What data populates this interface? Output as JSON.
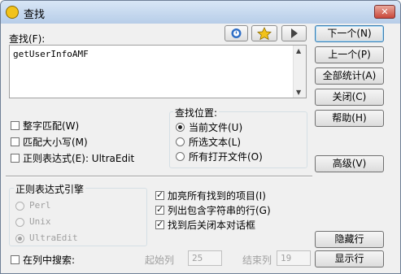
{
  "window": {
    "title": "查找",
    "close_glyph": "✕"
  },
  "find": {
    "label": "查找(F):",
    "value": "getUserInfoAMF"
  },
  "toolbar": {
    "icons": [
      "refresh-icon",
      "star-icon",
      "play-icon"
    ]
  },
  "buttons": {
    "next": "下一个(N)",
    "prev": "上一个(P)",
    "count_all": "全部统计(A)",
    "close": "关闭(C)",
    "help": "帮助(H)",
    "advanced": "高级(V)",
    "hide": "隐藏行",
    "show": "显示行"
  },
  "options": {
    "whole_word": {
      "label": "整字匹配(W)",
      "checked": false
    },
    "match_case": {
      "label": "匹配大小写(M)",
      "checked": false
    },
    "regex": {
      "label": "正则表达式(E): UltraEdit",
      "checked": false
    }
  },
  "location": {
    "title": "查找位置:",
    "items": [
      {
        "label": "当前文件(U)",
        "checked": true
      },
      {
        "label": "所选文本(L)",
        "checked": false
      },
      {
        "label": "所有打开文件(O)",
        "checked": false
      }
    ]
  },
  "regex_engine": {
    "title": "正则表达式引擎",
    "items": [
      {
        "label": "Perl",
        "checked": false
      },
      {
        "label": "Unix",
        "checked": false
      },
      {
        "label": "UltraEdit",
        "checked": true
      }
    ]
  },
  "extra": {
    "items": [
      {
        "label": "加亮所有找到的项目(I)",
        "checked": true
      },
      {
        "label": "列出包含字符串的行(G)",
        "checked": true
      },
      {
        "label": "找到后关闭本对话框",
        "checked": true
      }
    ]
  },
  "column": {
    "search_in_column": "在列中搜索:",
    "start_label": "起始列",
    "start_value": "25",
    "end_label": "结束列",
    "end_value": "19"
  }
}
